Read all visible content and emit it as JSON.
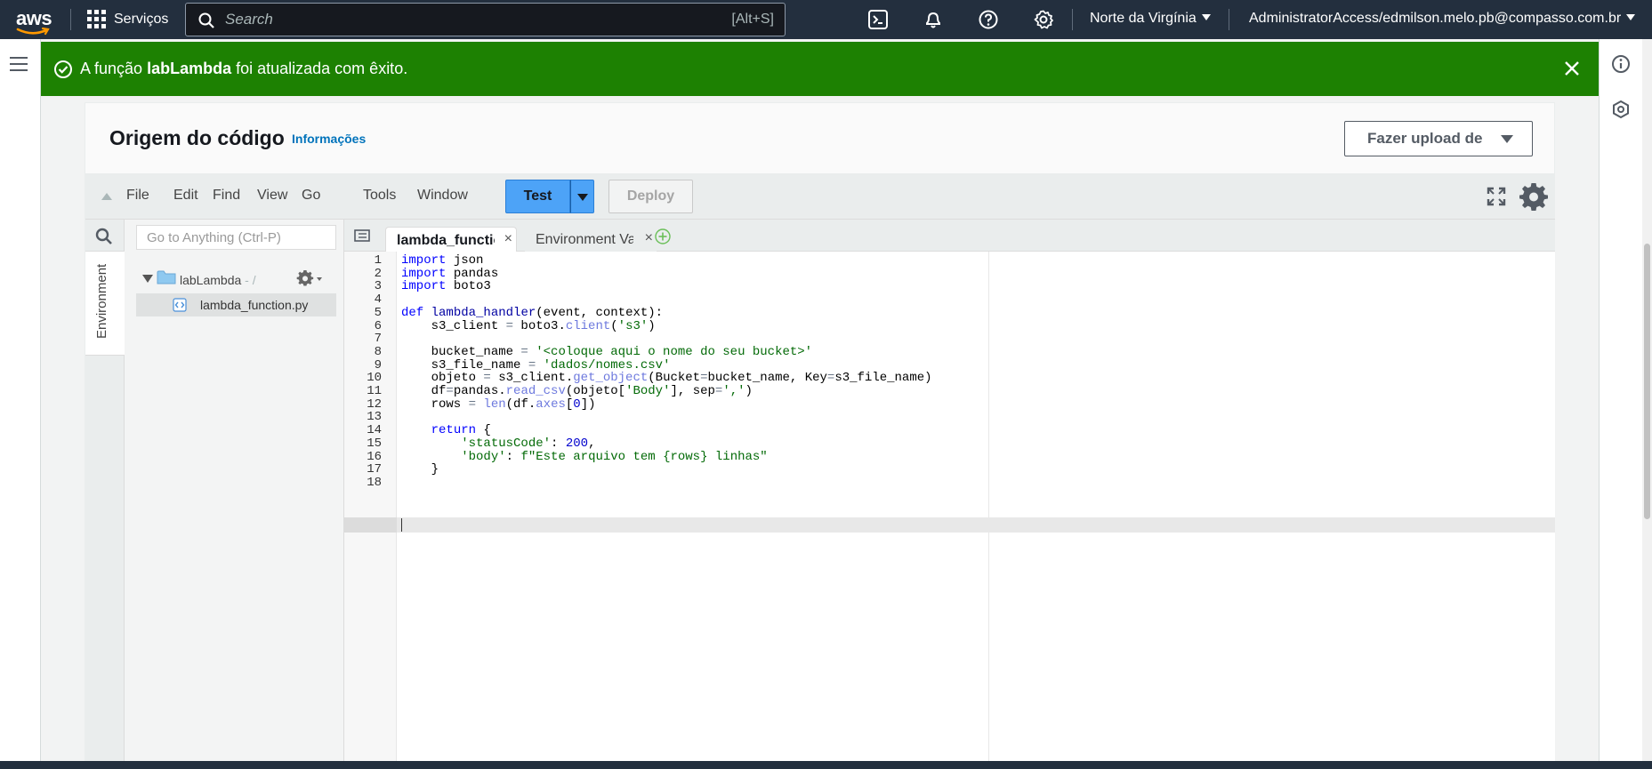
{
  "topnav": {
    "logo": "aws",
    "services_label": "Serviços",
    "search_placeholder": "Search",
    "search_shortcut": "[Alt+S]",
    "region_label": "Norte da Virgínia",
    "account_label": "AdministratorAccess/edmilson.melo.pb@compasso.com.br",
    "icons": [
      "grid-icon",
      "cloudshell-icon",
      "bell-icon",
      "help-icon",
      "settings-icon"
    ]
  },
  "flash": {
    "prefix": "A função ",
    "function_name": "labLambda",
    "suffix": " foi atualizada com êxito.",
    "color": "#1d8102"
  },
  "header": {
    "title": "Origem do código",
    "info_link": "Informações",
    "upload_label": "Fazer upload de"
  },
  "ide": {
    "menu": [
      "File",
      "Edit",
      "Find",
      "View",
      "Go",
      "Tools",
      "Window"
    ],
    "test_label": "Test",
    "deploy_label": "Deploy",
    "goto_placeholder": "Go to Anything (Ctrl-P)",
    "side_tab_label": "Environment",
    "tree": {
      "root_name": "labLambda",
      "root_path": " - /",
      "file_name": "lambda_function.py"
    },
    "tabs": [
      {
        "label": "lambda_function",
        "active": true
      },
      {
        "label": "Environment Var",
        "active": false
      }
    ],
    "code_lines": [
      "import json",
      "import pandas",
      "import boto3",
      "",
      "def lambda_handler(event, context):",
      "    s3_client = boto3.client('s3')",
      "",
      "    bucket_name = '<coloque aqui o nome do seu bucket>'",
      "    s3_file_name = 'dados/nomes.csv'",
      "    objeto = s3_client.get_object(Bucket=bucket_name, Key=s3_file_name)",
      "    df=pandas.read_csv(objeto['Body'], sep=',')",
      "    rows = len(df.axes[0])",
      "",
      "    return {",
      "        'statusCode': 200,",
      "        'body': f\"Este arquivo tem {rows} linhas\"",
      "    }",
      ""
    ],
    "line_numbers": [
      "1",
      "2",
      "3",
      "4",
      "5",
      "6",
      "7",
      "8",
      "9",
      "10",
      "11",
      "12",
      "13",
      "14",
      "15",
      "16",
      "17",
      "18"
    ],
    "accent_color": "#4da3f7"
  }
}
